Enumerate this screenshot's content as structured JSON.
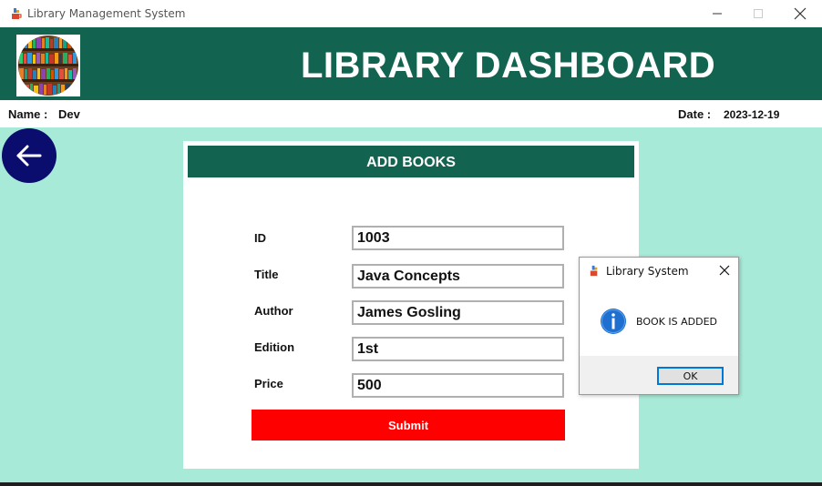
{
  "window": {
    "title": "Library Management System",
    "icon": "java-cup-icon"
  },
  "header": {
    "title": "LIBRARY DASHBOARD",
    "logo": "bookshelf-logo"
  },
  "info": {
    "name_label": "Name :",
    "name_value": "Dev",
    "date_label": "Date :",
    "date_value": "2023-12-19"
  },
  "form": {
    "title": "ADD BOOKS",
    "fields": [
      {
        "label": "ID",
        "value": "1003"
      },
      {
        "label": "Title",
        "value": "Java Concepts"
      },
      {
        "label": "Author",
        "value": "James Gosling"
      },
      {
        "label": "Edition",
        "value": "1st"
      },
      {
        "label": "Price",
        "value": "500"
      }
    ],
    "submit_label": "Submit"
  },
  "dialog": {
    "title": "Library System",
    "message": "BOOK IS ADDED",
    "ok_label": "OK",
    "icon": "info-icon"
  },
  "colors": {
    "header_green": "#126450",
    "background_mint": "#a8ead8",
    "back_button_navy": "#0a0c6e",
    "submit_red": "#ff0000",
    "dialog_accent": "#0078d7"
  }
}
